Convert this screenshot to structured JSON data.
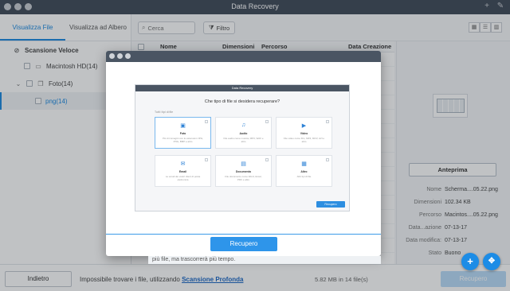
{
  "window": {
    "title": "Data Recovery"
  },
  "sidebar": {
    "tabs": [
      "Visualizza File",
      "Visualizza ad Albero"
    ],
    "scan_label": "Scansione Veloce",
    "tree": [
      {
        "label": "Macintosh HD(14)"
      },
      {
        "label": "Foto(14)"
      },
      {
        "label": "png(14)"
      }
    ]
  },
  "toolbar": {
    "search_placeholder": "Cerca",
    "filter_label": "Filtro"
  },
  "table": {
    "columns": [
      "Nome",
      "Dimensioni",
      "Percorso",
      "Data Creazione"
    ]
  },
  "preview": {
    "button_label": "Anteprima",
    "meta": [
      {
        "key": "Nome",
        "value": "Scherma....05.22.png"
      },
      {
        "key": "Dimensioni",
        "value": "102.34 KB"
      },
      {
        "key": "Percorso",
        "value": "Macintos....05.22.png"
      },
      {
        "key": "Data...azione",
        "value": "07-13-17"
      },
      {
        "key": "Data modifica:",
        "value": "07-13-17"
      },
      {
        "key": "Stato",
        "value": "Buono"
      }
    ]
  },
  "bottom": {
    "back_label": "Indietro",
    "message": "Impossibile trovare i file, utilizzando",
    "deep_scan_link": "Scansione Profonda",
    "size_info": "5.82 MB in 14 file(s)",
    "recover_label": "Recupero"
  },
  "modal": {
    "recover_label": "Recupero",
    "tooltip": "più file, ma trascorrerà più tempo.",
    "inner": {
      "title": "Data Recovery",
      "question": "Che tipo di file si desidera recuperare?",
      "all_types": "Tutti i tipi di file",
      "cards": [
        {
          "name": "Foto",
          "icon": "▣",
          "desc": "Più di immagini con le estensioni JPG, PNG, BMP e altro"
        },
        {
          "name": "Audio",
          "icon": "♫",
          "desc": "File audio come musica, MP3, WAV e altro"
        },
        {
          "name": "Video",
          "icon": "▶",
          "desc": "File video come film, MP4, MOV, AVI e altro"
        },
        {
          "name": "Email",
          "icon": "✉",
          "desc": "Le email dei vostri client di posta elettronica"
        },
        {
          "name": "Documento",
          "icon": "▤",
          "desc": "File documento come Word, Excel, PDF e altro"
        },
        {
          "name": "Altro",
          "icon": "▦",
          "desc": "Altri tipi di file"
        }
      ],
      "button_label": "Recupero"
    }
  },
  "colors": {
    "accent": "#1a88e0",
    "titlebar": "#3f4a58",
    "button": "#2e95ea"
  }
}
